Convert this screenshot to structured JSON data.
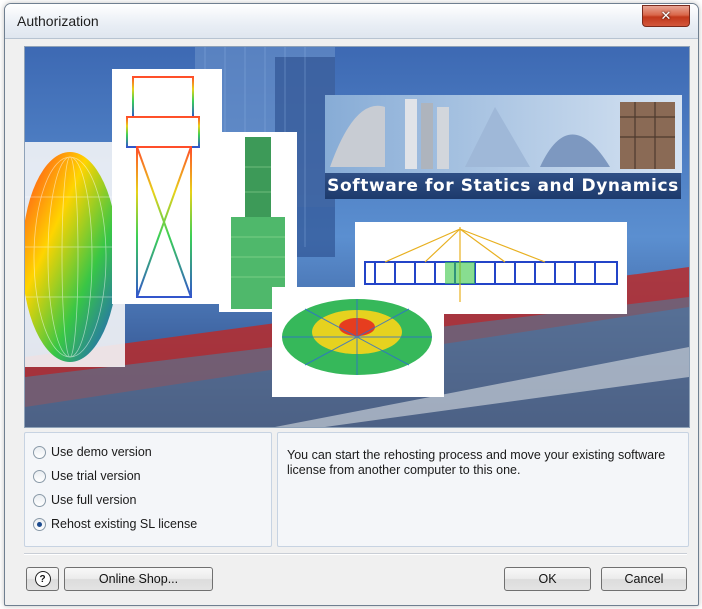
{
  "window": {
    "title": "Authorization",
    "close_glyph": "✕"
  },
  "banner": {
    "caption": "Software for Statics and Dynamics"
  },
  "options": [
    {
      "label": "Use demo version",
      "checked": false
    },
    {
      "label": "Use trial version",
      "checked": false
    },
    {
      "label": "Use full version",
      "checked": false
    },
    {
      "label": "Rehost existing SL license",
      "checked": true
    }
  ],
  "description": "You can start the rehosting process and move your existing software license from another computer to this one.",
  "buttons": {
    "help_glyph": "?",
    "shop_label": "Online Shop...",
    "ok_label": "OK",
    "cancel_label": "Cancel"
  },
  "colors": {
    "selected_radio": "#1c4b8f",
    "close_button": "#c2381b"
  }
}
